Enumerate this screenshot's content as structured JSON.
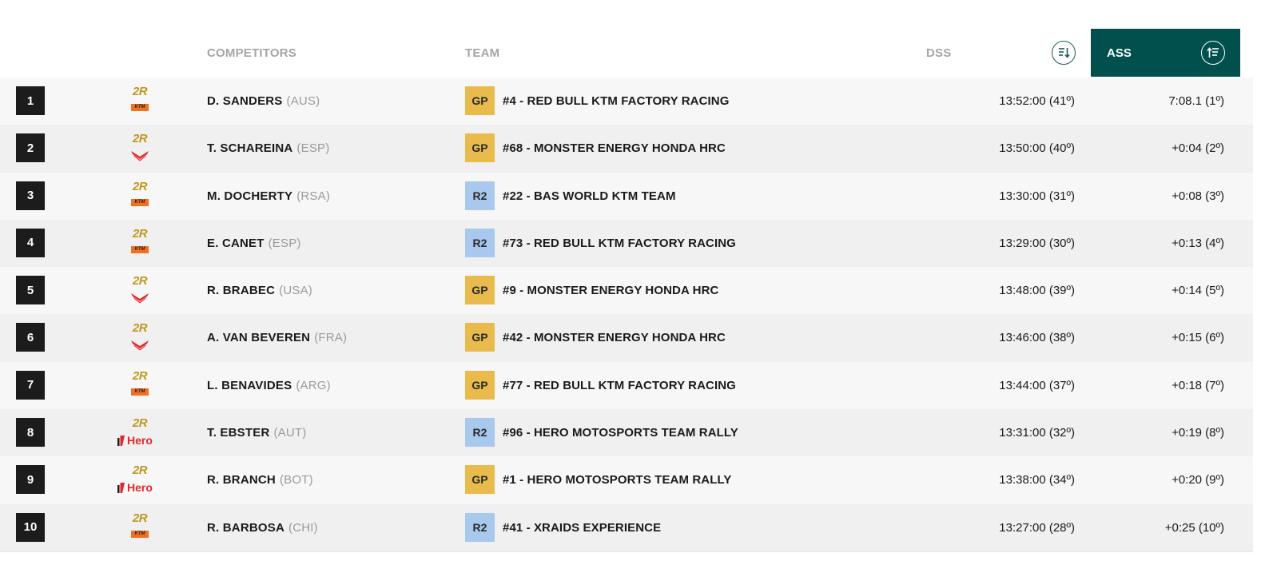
{
  "header": {
    "competitors": "COMPETITORS",
    "team": "TEAM",
    "dss": "DSS",
    "ass": "ASS"
  },
  "colors": {
    "ass_header_bg": "#02504e",
    "gp_badge": "#e9bb4d",
    "r2_badge": "#a8c8ee",
    "rank_bg": "#1c1c1c",
    "brand_gold": "#c0961c",
    "ktm_orange": "#f37021",
    "honda_red": "#e4252b"
  },
  "rows": [
    {
      "rank": "1",
      "class_badge": "2R",
      "brand": "ktm",
      "brand_label": "KTM",
      "name": "D. SANDERS",
      "country": "(AUS)",
      "category": "GP",
      "team": "#4 - RED BULL KTM FACTORY RACING",
      "dss": "13:52:00 (41º)",
      "ass": "7:08.1 (1º)"
    },
    {
      "rank": "2",
      "class_badge": "2R",
      "brand": "honda",
      "brand_label": "",
      "name": "T. SCHAREINA",
      "country": "(ESP)",
      "category": "GP",
      "team": "#68 - MONSTER ENERGY HONDA HRC",
      "dss": "13:50:00 (40º)",
      "ass": "+0:04 (2º)"
    },
    {
      "rank": "3",
      "class_badge": "2R",
      "brand": "ktm",
      "brand_label": "KTM",
      "name": "M. DOCHERTY",
      "country": "(RSA)",
      "category": "R2",
      "team": "#22 - BAS WORLD KTM TEAM",
      "dss": "13:30:00 (31º)",
      "ass": "+0:08 (3º)"
    },
    {
      "rank": "4",
      "class_badge": "2R",
      "brand": "ktm",
      "brand_label": "KTM",
      "name": "E. CANET",
      "country": "(ESP)",
      "category": "R2",
      "team": "#73 - RED BULL KTM FACTORY RACING",
      "dss": "13:29:00 (30º)",
      "ass": "+0:13 (4º)"
    },
    {
      "rank": "5",
      "class_badge": "2R",
      "brand": "honda",
      "brand_label": "",
      "name": "R. BRABEC",
      "country": "(USA)",
      "category": "GP",
      "team": "#9 - MONSTER ENERGY HONDA HRC",
      "dss": "13:48:00 (39º)",
      "ass": "+0:14 (5º)"
    },
    {
      "rank": "6",
      "class_badge": "2R",
      "brand": "honda",
      "brand_label": "",
      "name": "A. VAN BEVEREN",
      "country": "(FRA)",
      "category": "GP",
      "team": "#42 - MONSTER ENERGY HONDA HRC",
      "dss": "13:46:00 (38º)",
      "ass": "+0:15 (6º)"
    },
    {
      "rank": "7",
      "class_badge": "2R",
      "brand": "ktm",
      "brand_label": "KTM",
      "name": "L. BENAVIDES",
      "country": "(ARG)",
      "category": "GP",
      "team": "#77 - RED BULL KTM FACTORY RACING",
      "dss": "13:44:00 (37º)",
      "ass": "+0:18 (7º)"
    },
    {
      "rank": "8",
      "class_badge": "2R",
      "brand": "hero",
      "brand_label": "Hero",
      "name": "T. EBSTER",
      "country": "(AUT)",
      "category": "R2",
      "team": "#96 - HERO MOTOSPORTS TEAM RALLY",
      "dss": "13:31:00 (32º)",
      "ass": "+0:19 (8º)"
    },
    {
      "rank": "9",
      "class_badge": "2R",
      "brand": "hero",
      "brand_label": "Hero",
      "name": "R. BRANCH",
      "country": "(BOT)",
      "category": "GP",
      "team": "#1 - HERO MOTOSPORTS TEAM RALLY",
      "dss": "13:38:00 (34º)",
      "ass": "+0:20 (9º)"
    },
    {
      "rank": "10",
      "class_badge": "2R",
      "brand": "ktm",
      "brand_label": "KTM",
      "name": "R. BARBOSA",
      "country": "(CHI)",
      "category": "R2",
      "team": "#41 - XRAIDS EXPERIENCE",
      "dss": "13:27:00 (28º)",
      "ass": "+0:25 (10º)"
    }
  ]
}
